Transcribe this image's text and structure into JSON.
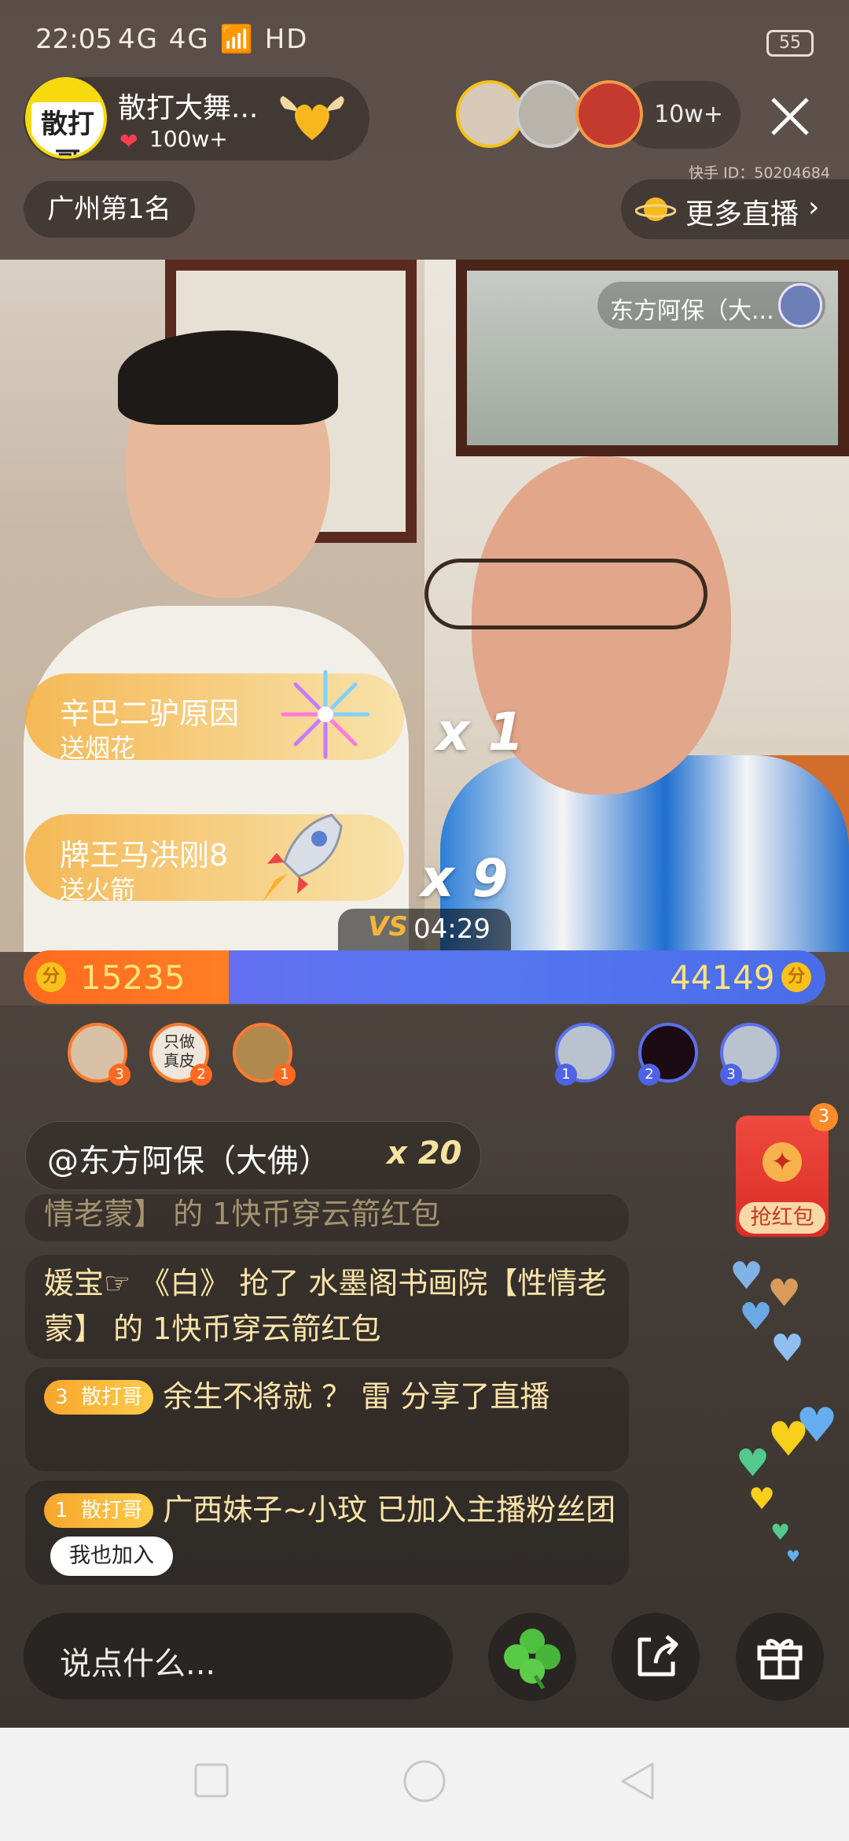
{
  "status_bar": {
    "time": "22:05",
    "signal": "4G 4G",
    "network": "HD",
    "battery": "55"
  },
  "streamer": {
    "avatar_text": "散打哥",
    "name": "散打大舞...",
    "likes": "100w+"
  },
  "viewers": {
    "count": "10w+"
  },
  "kuaishou_id": "快手 ID：50204684",
  "rank": "广州第1名",
  "more_live": "更多直播",
  "opponent": {
    "name": "东方阿保（大..."
  },
  "gifts": [
    {
      "user": "辛巴二驴原因",
      "action": "送烟花",
      "multiplier": "x 1"
    },
    {
      "user": "牌王马洪刚8",
      "action": "送火箭",
      "multiplier": "x 9"
    }
  ],
  "pk": {
    "timer": "04:29",
    "vs": "VS",
    "score_left": "15235",
    "score_right": "44149",
    "coin_glyph": "分",
    "left_share": 0.256
  },
  "contributors": {
    "left": [
      {
        "rank": "3"
      },
      {
        "rank": "2",
        "text": "只做真皮"
      },
      {
        "rank": "1"
      }
    ],
    "right": [
      {
        "rank": "1"
      },
      {
        "rank": "2"
      },
      {
        "rank": "3"
      }
    ]
  },
  "red_packet": {
    "label": "抢红包",
    "count": "3"
  },
  "chat": {
    "mention": "@东方阿保（大佛）",
    "mention_count": "x 20",
    "messages": [
      {
        "text": "情老蒙】 的 1快币穿云箭红包"
      },
      {
        "text": "媛宝☞ 《白》 抢了 水墨阁书画院【性情老蒙】 的 1快币穿云箭红包"
      },
      {
        "badge_level": "3",
        "badge_name": "散打哥",
        "text": "余生不将就 ？ 雷 分享了直播"
      },
      {
        "badge_level": "1",
        "badge_name": "散打哥",
        "text": "广西妹子~小玟 已加入主播粉丝团",
        "button": "我也加入"
      }
    ]
  },
  "input": {
    "placeholder": "说点什么..."
  },
  "colors": {
    "pk_left": "#ff6a20",
    "pk_right": "#5476ef",
    "accent_gold": "#fde37a"
  }
}
